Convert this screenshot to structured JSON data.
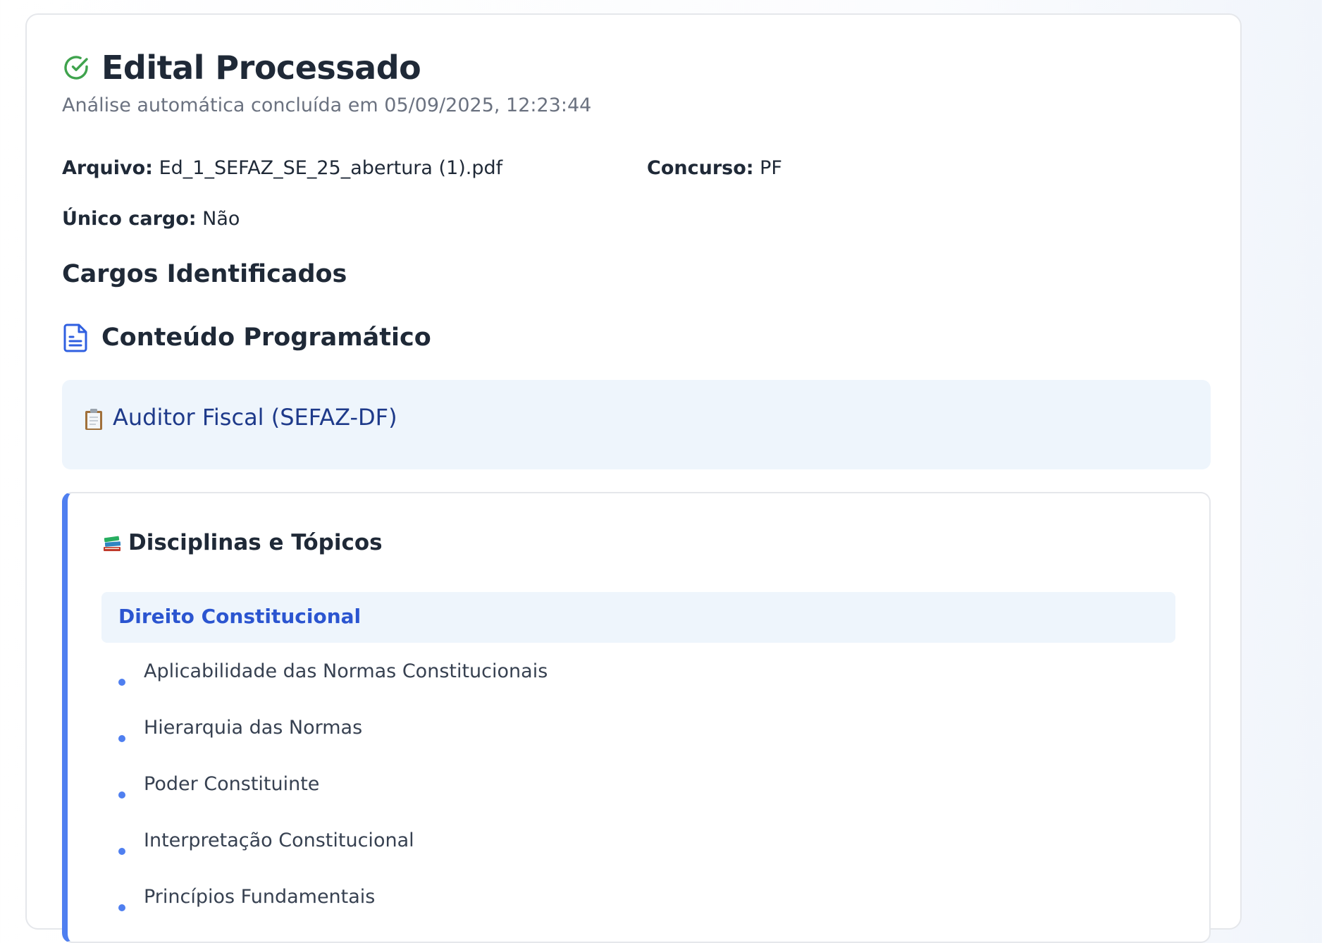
{
  "header": {
    "title": "Edital Processado",
    "subtitle": "Análise automática concluída em 05/09/2025, 12:23:44",
    "icon": "check-circle-icon",
    "icon_color": "#3fa34d"
  },
  "fields": {
    "arquivo_label": "Arquivo:",
    "arquivo_value": "Ed_1_SEFAZ_SE_25_abertura (1).pdf",
    "concurso_label": "Concurso:",
    "concurso_value": "PF",
    "unico_label": "Único cargo:",
    "unico_value": "Não"
  },
  "sections": {
    "cargos_title": "Cargos Identificados",
    "conteudo_title": "Conteúdo Programático",
    "conteudo_icon": "document-icon"
  },
  "cargo": {
    "icon": "clipboard-icon",
    "title": "Auditor Fiscal (SEFAZ-DF)"
  },
  "disciplinas": {
    "icon": "books-icon",
    "title": "Disciplinas e Tópicos",
    "subject": "Direito Constitucional",
    "topics": [
      "Aplicabilidade das Normas Constitucionais",
      "Hierarquia das Normas",
      "Poder Constituinte",
      "Interpretação Constitucional",
      "Princípios Fundamentais"
    ]
  },
  "colors": {
    "accent": "#4f7ff0",
    "subject_text": "#2b55d0",
    "cargo_text": "#1e3a8a",
    "panel_bg": "#eef5fc"
  }
}
